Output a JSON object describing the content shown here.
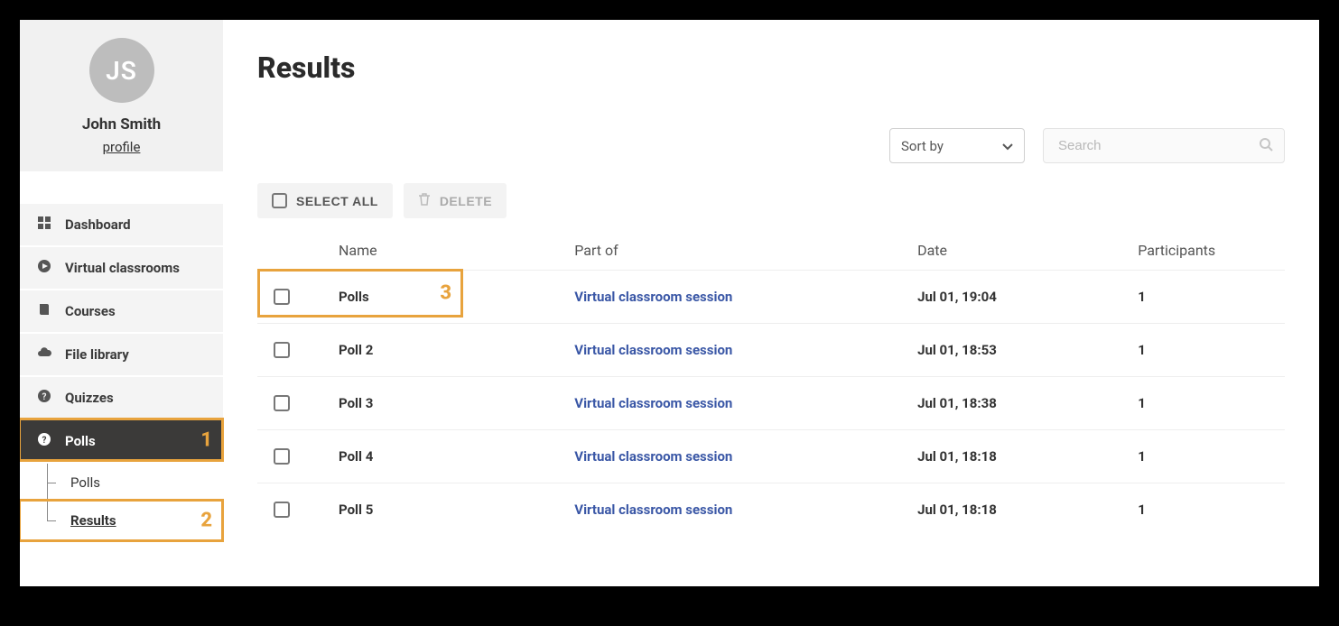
{
  "user": {
    "initials": "JS",
    "name": "John Smith",
    "profile_link": "profile"
  },
  "nav": {
    "items": [
      {
        "icon": "grid",
        "label": "Dashboard"
      },
      {
        "icon": "play",
        "label": "Virtual classrooms"
      },
      {
        "icon": "book",
        "label": "Courses"
      },
      {
        "icon": "cloud",
        "label": "File library"
      },
      {
        "icon": "question",
        "label": "Quizzes"
      },
      {
        "icon": "question",
        "label": "Polls"
      }
    ],
    "sub": [
      {
        "label": "Polls"
      },
      {
        "label": "Results"
      }
    ]
  },
  "page": {
    "title": "Results",
    "sort_label": "Sort by",
    "search_placeholder": "Search",
    "select_all": "SELECT ALL",
    "delete": "DELETE"
  },
  "table": {
    "headers": {
      "name": "Name",
      "part_of": "Part of",
      "date": "Date",
      "participants": "Participants"
    },
    "rows": [
      {
        "name": "Polls",
        "part_of": "Virtual classroom session",
        "date": "Jul 01, 19:04",
        "participants": "1"
      },
      {
        "name": "Poll 2",
        "part_of": "Virtual classroom session",
        "date": "Jul 01, 18:53",
        "participants": "1"
      },
      {
        "name": "Poll 3",
        "part_of": "Virtual classroom session",
        "date": "Jul 01, 18:38",
        "participants": "1"
      },
      {
        "name": "Poll 4",
        "part_of": "Virtual classroom session",
        "date": "Jul 01, 18:18",
        "participants": "1"
      },
      {
        "name": "Poll 5",
        "part_of": "Virtual classroom session",
        "date": "Jul 01, 18:18",
        "participants": "1"
      }
    ]
  },
  "annotations": {
    "one": "1",
    "two": "2",
    "three": "3"
  }
}
